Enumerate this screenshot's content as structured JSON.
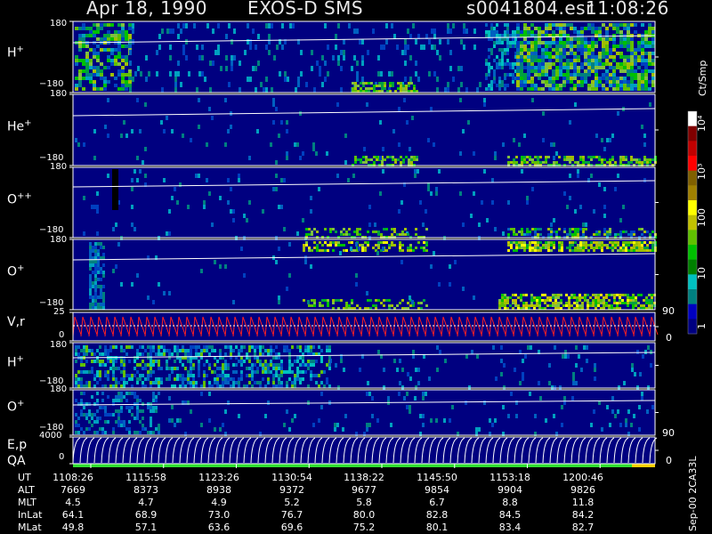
{
  "header": {
    "date": "Apr 18, 1990",
    "instrument": "EXOS-D SMS",
    "file": "s0041804.esr",
    "time": "11:08:26"
  },
  "panels": [
    {
      "id": "h1",
      "label": "H",
      "sup": "+",
      "tick_top": "180",
      "tick_bottom": "−180"
    },
    {
      "id": "he",
      "label": "He",
      "sup": "+",
      "tick_top": "180",
      "tick_bottom": "−180"
    },
    {
      "id": "opp",
      "label": "O",
      "sup": "++",
      "tick_top": "180",
      "tick_bottom": "−180"
    },
    {
      "id": "o1",
      "label": "O",
      "sup": "+",
      "tick_top": "180",
      "tick_bottom": "−180"
    },
    {
      "id": "vr",
      "label": "V,r",
      "sup": "",
      "tick_top": "25",
      "tick_bottom": "0",
      "rtick_top": "90",
      "rtick_bottom": "0"
    },
    {
      "id": "h2",
      "label": "H",
      "sup": "+",
      "tick_top": "180",
      "tick_bottom": "−180"
    },
    {
      "id": "o2",
      "label": "O",
      "sup": "+",
      "tick_top": "180",
      "tick_bottom": "−180"
    },
    {
      "id": "ep",
      "label": "E,p",
      "sup": "",
      "label2": "QA",
      "tick_top": "4000",
      "tick_bottom": "0",
      "rtick_top": "90",
      "rtick_bottom": "0"
    }
  ],
  "colorbar": {
    "unit": "Ct/Smp",
    "labels": [
      "10⁴",
      "10³",
      "100",
      "10",
      "1"
    ],
    "colors": [
      "#ffffff",
      "#800000",
      "#c00000",
      "#ff0000",
      "#806000",
      "#a08000",
      "#ffff00",
      "#c0c000",
      "#60c000",
      "#00c000",
      "#008000",
      "#00c0c0",
      "#008080",
      "#0000c0",
      "#000080"
    ]
  },
  "footer_code": "Sep-00  2CA33L",
  "table": {
    "rows": [
      {
        "name": "UT",
        "values": [
          "1108:26",
          "1115:58",
          "1123:26",
          "1130:54",
          "1138:22",
          "1145:50",
          "1153:18",
          "1200:46"
        ]
      },
      {
        "name": "ALT",
        "values": [
          "7669",
          "8373",
          "8938",
          "9372",
          "9677",
          "9854",
          "9904",
          "9826"
        ]
      },
      {
        "name": "MLT",
        "values": [
          "4.5",
          "4.7",
          "4.9",
          "5.2",
          "5.8",
          "6.7",
          "8.8",
          "11.8"
        ]
      },
      {
        "name": "InLat",
        "values": [
          "64.1",
          "68.9",
          "73.0",
          "76.7",
          "80.0",
          "82.8",
          "84.5",
          "84.2"
        ]
      },
      {
        "name": "MLat",
        "values": [
          "49.8",
          "57.1",
          "63.6",
          "69.6",
          "75.2",
          "80.1",
          "83.4",
          "82.7"
        ]
      }
    ]
  },
  "chart_data": {
    "type": "heatmap",
    "title": "Apr 18, 1990   EXOS-D SMS",
    "x": [
      "1108:26",
      "1115:58",
      "1123:26",
      "1130:54",
      "1138:22",
      "1145:50",
      "1153:18",
      "1200:46"
    ],
    "xlabel": "UT",
    "series": [
      {
        "name": "H+",
        "ylim": [
          -180,
          180
        ]
      },
      {
        "name": "He+",
        "ylim": [
          -180,
          180
        ]
      },
      {
        "name": "O++",
        "ylim": [
          -180,
          180
        ]
      },
      {
        "name": "O+",
        "ylim": [
          -180,
          180
        ]
      },
      {
        "name": "V,r",
        "ylim": [
          0,
          25
        ],
        "right_ylim": [
          0,
          90
        ]
      },
      {
        "name": "H+",
        "ylim": [
          -180,
          180
        ]
      },
      {
        "name": "O+",
        "ylim": [
          -180,
          180
        ]
      },
      {
        "name": "E,p",
        "ylim": [
          0,
          4000
        ],
        "right_ylim": [
          0,
          90
        ]
      }
    ],
    "colorscale": {
      "unit": "Ct/Smp",
      "range": [
        1,
        10000
      ],
      "scale": "log"
    }
  }
}
